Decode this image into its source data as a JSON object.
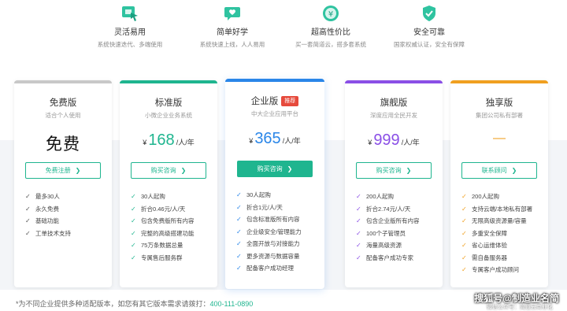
{
  "features": [
    {
      "icon": "cursor-window-icon",
      "title": "灵活易用",
      "desc": "系统快速迭代、多端使用"
    },
    {
      "icon": "heart-chat-icon",
      "title": "简单好学",
      "desc": "系统快速上线，人人易用"
    },
    {
      "icon": "yuan-coin-icon",
      "title": "超高性价比",
      "desc": "买一套简道云，搭多套系统"
    },
    {
      "icon": "shield-check-icon",
      "title": "安全可靠",
      "desc": "国家权威认证，安全有保障"
    }
  ],
  "colors": {
    "accent": "#1fb58f",
    "free": "#c8c8c8",
    "standard": "#1fb58f",
    "enterprise": "#2a86e8",
    "flagship": "#8a4fe6",
    "exclusive": "#f0a020"
  },
  "plans": [
    {
      "name": "免费版",
      "sub": "适合个人使用",
      "price_text": "免费",
      "button": "免费注册",
      "items": [
        "最多30人",
        "永久免费",
        "基础功能",
        "工单技术支持"
      ]
    },
    {
      "name": "标准版",
      "sub": "小微企业业务系统",
      "currency": "¥",
      "price": "168",
      "unit": "/人/年",
      "button": "购买咨询",
      "items": [
        "30人起购",
        "折合0.46元/人/天",
        "包含免费版所有内容",
        "完整的高级搭建功能",
        "75万条数据总量",
        "专属售后服务群"
      ]
    },
    {
      "name": "企业版",
      "badge": "推荐",
      "sub": "中大企业应用平台",
      "currency": "¥",
      "price": "365",
      "unit": "/人/年",
      "button": "购买咨询",
      "items": [
        "30人起购",
        "折合1元/人/天",
        "包含标准版所有内容",
        "企业级安全/管理能力",
        "全面开放与对接能力",
        "更多资源与数据容量",
        "配备客户成功经理"
      ]
    },
    {
      "name": "旗舰版",
      "sub": "深度应用全民开发",
      "currency": "¥",
      "price": "999",
      "unit": "/人/年",
      "button": "购买咨询",
      "items": [
        "200人起购",
        "折合2.74元/人/天",
        "包含企业版所有内容",
        "100个子管理员",
        "海量高级资源",
        "配备客户成功专家"
      ]
    },
    {
      "name": "独享版",
      "sub": "集团公司私有部署",
      "price_text": "—",
      "button": "联系顾问",
      "items": [
        "200人起购",
        "支持云端/本地私有部署",
        "无限高级资源量/容量",
        "多重安全保障",
        "省心运维体验",
        "需自备服务器",
        "专属客户成功顾问"
      ]
    }
  ],
  "footnote": {
    "text": "*为不同企业提供多种适配版本，如您有其它版本需求请拨打：",
    "phone": "400-111-0890"
  },
  "watermark": {
    "main": "搜狐号@制造业名简",
    "sub": "微信公众号：简道云商业化"
  }
}
